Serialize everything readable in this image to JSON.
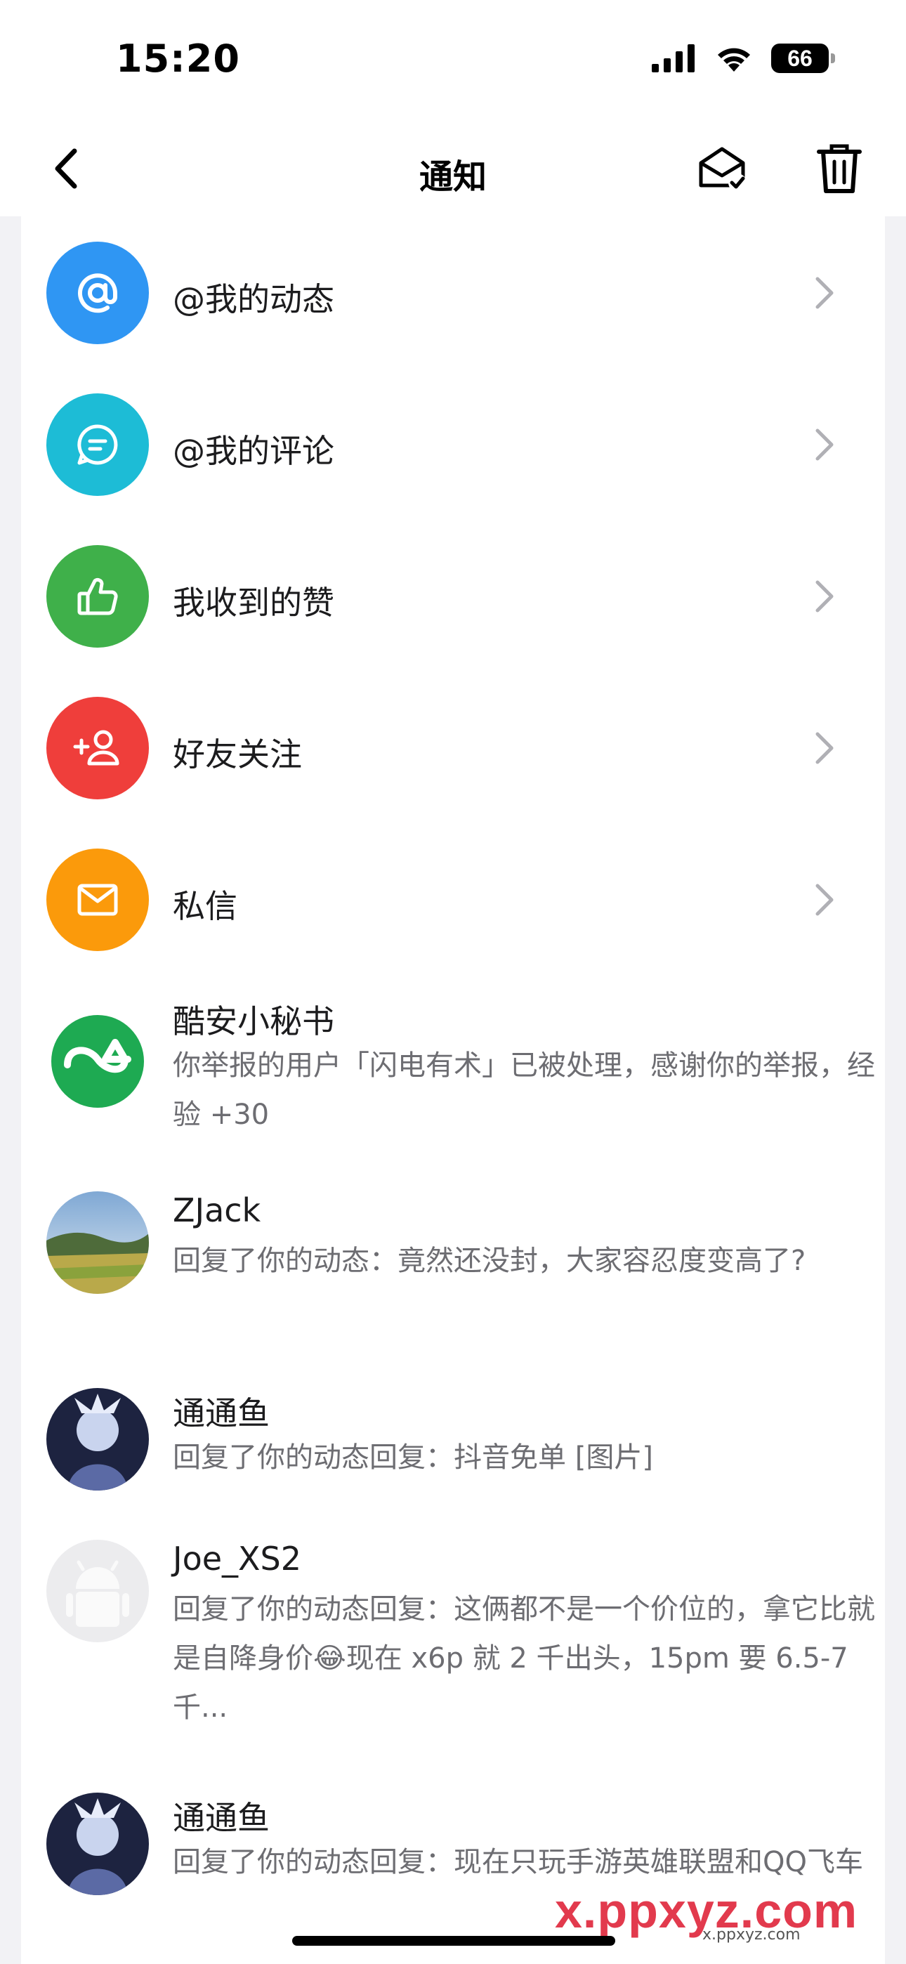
{
  "status_bar": {
    "time": "15:20",
    "battery": "66"
  },
  "nav": {
    "title": "通知"
  },
  "categories": [
    {
      "label": "@我的动态",
      "icon": "at-icon",
      "color": "#2f96f3"
    },
    {
      "label": "@我的评论",
      "icon": "comment-icon",
      "color": "#1dbcd6"
    },
    {
      "label": "我收到的赞",
      "icon": "thumbs-up-icon",
      "color": "#3fb04a"
    },
    {
      "label": "好友关注",
      "icon": "add-user-icon",
      "color": "#ef3e3b"
    },
    {
      "label": "私信",
      "icon": "mail-icon",
      "color": "#fb9a0b"
    }
  ],
  "messages": [
    {
      "name": "酷安小秘书",
      "body": "你举报的用户「闪电有术」已被处理，感谢你的举报，经验 +30"
    },
    {
      "name": "ZJack",
      "body": "回复了你的动态：竟然还没封，大家容忍度变高了?"
    },
    {
      "name": "通通鱼",
      "body": "回复了你的动态回复：抖音免单 [图片]"
    },
    {
      "name": "Joe_XS2",
      "body_before": "回复了你的动态回复：这俩都不是一个价位的，拿它比就是自降身价",
      "emoji": "😂",
      "body_after": "现在 x6p 就 2 千出头，15pm 要 6.5-7 千..."
    },
    {
      "name": "通通鱼",
      "body": "回复了你的动态回复：现在只玩手游英雄联盟和QQ飞车"
    }
  ],
  "watermark": {
    "text": "x.ppxyz.com",
    "sub": "x.ppxyz.com"
  }
}
